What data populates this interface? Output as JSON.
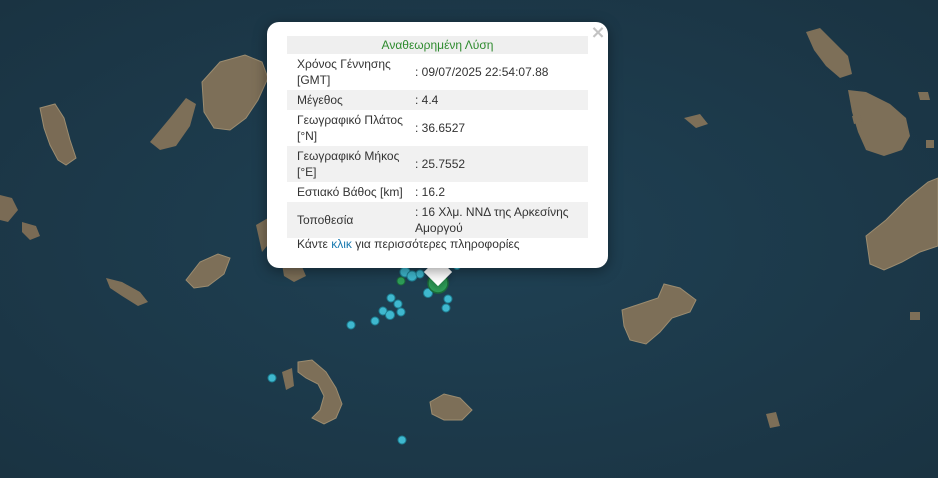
{
  "popup": {
    "title": "Αναθεωρημένη Λύση",
    "close_symbol": "×",
    "rows": [
      {
        "label": "Χρόνος Γέννησης [GMT]",
        "value": ": 09/07/2025 22:54:07.88"
      },
      {
        "label": "Μέγεθος",
        "value": ": 4.4"
      },
      {
        "label": "Γεωγραφικό Πλάτος [°N]",
        "value": ": 36.6527"
      },
      {
        "label": "Γεωγραφικό Μήκος [°E]",
        "value": ": 25.7552"
      },
      {
        "label": "Εστιακό Βάθος [km]",
        "value": ": 16.2"
      },
      {
        "label": "Τοποθεσία",
        "value": ": 16 Χλμ. ΝΝΔ της Αρκεσίνης Αμοργού"
      }
    ],
    "more_prefix": "Κάντε ",
    "more_link": "κλικ",
    "more_suffix": " για περισσότερες πληροφορίες"
  },
  "colors": {
    "sea": "#1d3a4b",
    "land": "#7d6f58",
    "quake_small": "#3fb8cf",
    "quake_selected": "#2e9e58",
    "title_green": "#2e8b2e",
    "link_blue": "#1a7ab0"
  }
}
